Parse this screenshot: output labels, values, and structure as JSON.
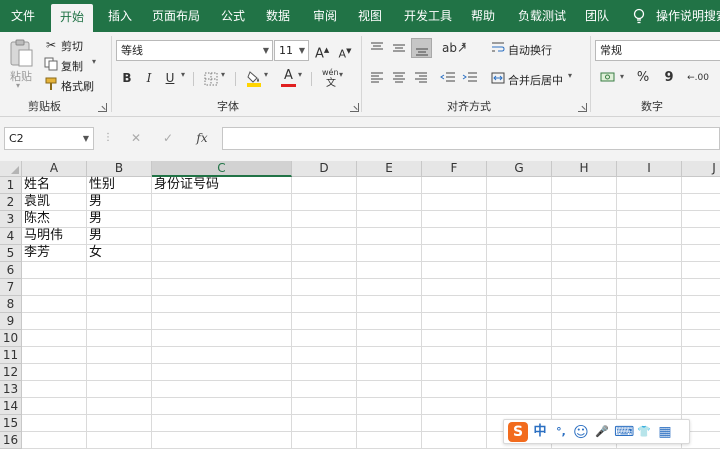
{
  "menu": {
    "tabs": [
      "文件",
      "开始",
      "插入",
      "页面布局",
      "公式",
      "数据",
      "审阅",
      "视图",
      "开发工具",
      "帮助",
      "负载测试",
      "团队"
    ],
    "active_tab": "开始",
    "tell_me": "操作说明搜索",
    "bar_color": "#217346"
  },
  "ribbon": {
    "clipboard": {
      "paste": "粘贴",
      "cut": "剪切",
      "copy": "复制",
      "format_painter": "格式刷",
      "label": "剪贴板"
    },
    "font": {
      "font_name": "等线",
      "font_size": "11",
      "grow": "A",
      "shrink": "A",
      "bold": "B",
      "italic": "I",
      "underline": "U",
      "font_color_letter": "A",
      "phonetic": "wén",
      "label": "字体"
    },
    "alignment": {
      "wrap_text": "自动换行",
      "merge_center": "合并后居中",
      "label": "对齐方式"
    },
    "number": {
      "format": "常规",
      "percent": "%",
      "comma": "9",
      "label": "数字"
    }
  },
  "formula_bar": {
    "name_box": "C2",
    "cancel": "✕",
    "enter": "✓",
    "fx": "fx",
    "content": ""
  },
  "sheet": {
    "columns": [
      "A",
      "B",
      "C",
      "D",
      "E",
      "F",
      "G",
      "H",
      "I",
      "J"
    ],
    "selected_column": "C",
    "rows": [
      "1",
      "2",
      "3",
      "4",
      "5",
      "6",
      "7",
      "8",
      "9",
      "10",
      "11",
      "12",
      "13",
      "14",
      "15",
      "16"
    ],
    "cells": {
      "A1": "姓名",
      "B1": "性别",
      "C1": "身份证号码",
      "A2": "袁凯",
      "B2": "男",
      "A3": "陈杰",
      "B3": "男",
      "A4": "马明伟",
      "B4": "男",
      "A5": "李芳",
      "B5": "女"
    }
  },
  "ime": {
    "logo": "S",
    "mode": "中",
    "punct": "°,",
    "emoji": "☺",
    "mic": "🎤",
    "keyboard": "⌨",
    "skin": "👕",
    "grid": "▦"
  }
}
